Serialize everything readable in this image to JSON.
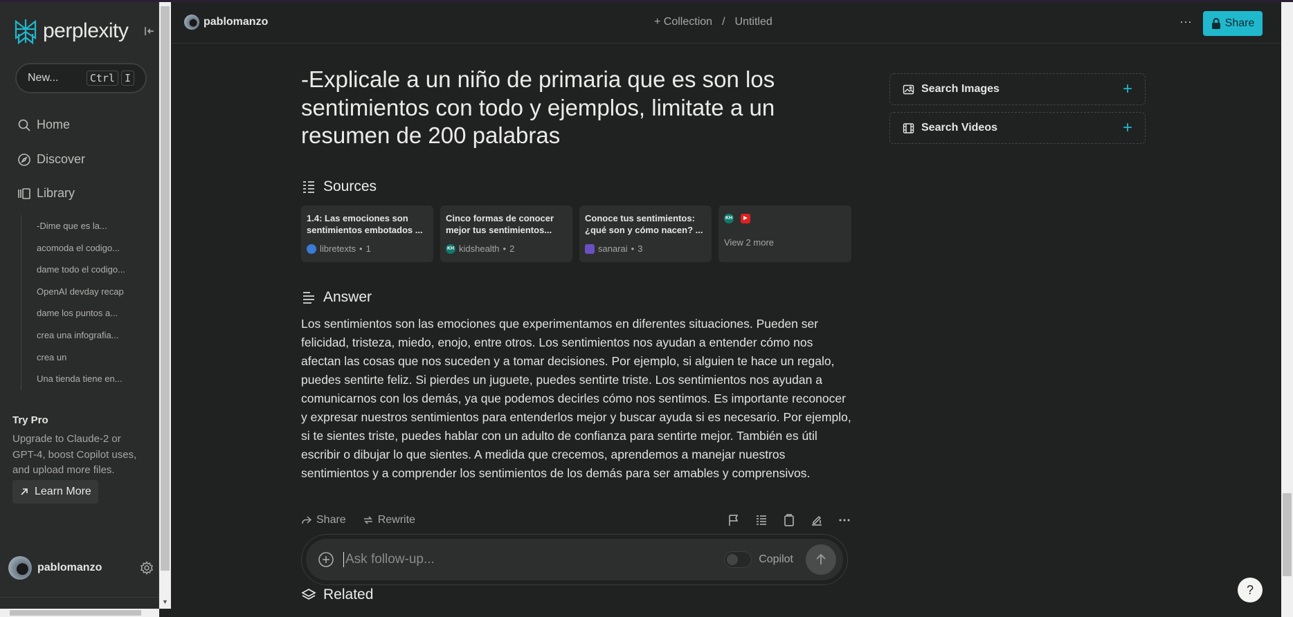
{
  "sidebar": {
    "brand": "perplexity",
    "new_label": "New...",
    "new_shortcut": [
      "Ctrl",
      "I"
    ],
    "nav": [
      {
        "label": "Home",
        "icon": "search-icon"
      },
      {
        "label": "Discover",
        "icon": "compass-icon"
      },
      {
        "label": "Library",
        "icon": "library-icon"
      }
    ],
    "library_items": [
      "-Dime que es la...",
      "acomoda el codigo...",
      "dame todo el codigo...",
      "OpenAI devday recap",
      "dame los puntos a...",
      "crea una infografia...",
      "crea un",
      "Una tienda tiene en..."
    ],
    "try_pro_title": "Try Pro",
    "try_pro_desc": "Upgrade to Claude-2 or GPT-4, boost Copilot uses, and upload more files.",
    "learn_more": "Learn More",
    "username": "pablomanzo"
  },
  "topbar": {
    "username": "pablomanzo",
    "collection": "Collection",
    "separator": "/",
    "doc_title": "Untitled",
    "more": "···",
    "share": "Share",
    "accent": "#20b8cd"
  },
  "thread": {
    "question": "-Explicale a un niño de primaria que es son los sentimientos con todo y ejemplos, limitate a un resumen de 200 palabras",
    "sources_heading": "Sources",
    "sources": [
      {
        "title": "1.4: Las emociones son sentimientos embotados ...",
        "site": "libretexts",
        "index": "1"
      },
      {
        "title": "Cinco formas de conocer mejor tus sentimientos...",
        "site": "kidshealth",
        "index": "2"
      },
      {
        "title": "Conoce tus sentimientos: ¿qué son y cómo nacen? ...",
        "site": "sanarai",
        "index": "3"
      }
    ],
    "view_more": "View 2 more",
    "answer_heading": "Answer",
    "answer": "Los sentimientos son las emociones que experimentamos en diferentes situaciones. Pueden ser felicidad, tristeza, miedo, enojo, entre otros. Los sentimientos nos ayudan a entender cómo nos afectan las cosas que nos suceden y a tomar decisiones. Por ejemplo, si alguien te hace un regalo, puedes sentirte feliz. Si pierdes un juguete, puedes sentirte triste. Los sentimientos nos ayudan a comunicarnos con los demás, ya que podemos decirles cómo nos sentimos. Es importante reconocer y expresar nuestros sentimientos para entenderlos mejor y buscar ayuda si es necesario. Por ejemplo, si te sientes triste, puedes hablar con un adulto de confianza para sentirte mejor. También es útil escribir o dibujar lo que sientes. A medida que crecemos, aprendemos a manejar nuestros sentimientos y a comprender los sentimientos de los demás para ser amables y comprensivos.",
    "share": "Share",
    "rewrite": "Rewrite",
    "followup_placeholder": "Ask follow-up...",
    "copilot": "Copilot",
    "related_heading": "Related"
  },
  "right_panel": {
    "search_images": "Search Images",
    "search_videos": "Search Videos"
  },
  "help": "?"
}
